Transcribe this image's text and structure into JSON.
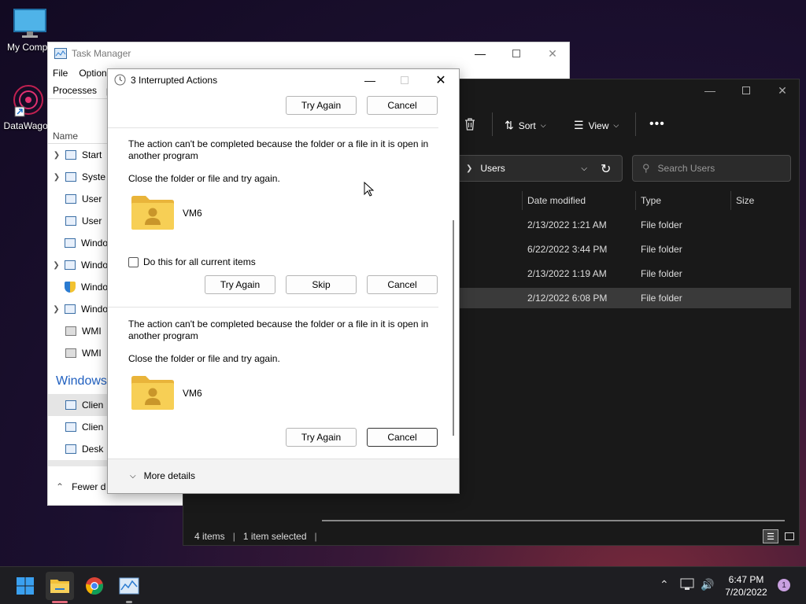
{
  "desktop": {
    "icons": [
      {
        "label": "My Compu"
      },
      {
        "label": "DataWagon"
      }
    ]
  },
  "task_manager": {
    "title": "Task Manager",
    "menu": [
      "File",
      "Option"
    ],
    "tabs": [
      "Processes",
      "p"
    ],
    "column_name": "Name",
    "rows": [
      "Start",
      "Syste",
      "User",
      "User",
      "Windo",
      "Windo",
      "Windo",
      "Windo",
      "WMI",
      "WMI"
    ],
    "section_label": "Windows",
    "section_rows": [
      "Clien",
      "Clien",
      "Desk"
    ],
    "fewer_details": "Fewer d"
  },
  "explorer": {
    "toolbar": {
      "sort": "Sort",
      "view": "View"
    },
    "address": {
      "paren": ")",
      "current": "Users"
    },
    "search_placeholder": "Search Users",
    "columns": {
      "date": "Date modified",
      "type": "Type",
      "size": "Size"
    },
    "rows": [
      {
        "date": "2/13/2022 1:21 AM",
        "type": "File folder"
      },
      {
        "date": "6/22/2022 3:44 PM",
        "type": "File folder"
      },
      {
        "date": "2/13/2022 1:19 AM",
        "type": "File folder"
      },
      {
        "date": "2/12/2022 6:08 PM",
        "type": "File folder",
        "selected": true
      }
    ],
    "status": {
      "items": "4 items",
      "selected": "1 item selected"
    }
  },
  "dialog": {
    "title": "3 Interrupted Actions",
    "top_buttons": {
      "try_again": "Try Again",
      "cancel": "Cancel"
    },
    "items": [
      {
        "message": "The action can't be completed because the folder or a file in it is open in another program",
        "hint": "Close the folder or file and try again.",
        "folder_name": "VM6",
        "checkbox_label": "Do this for all current items",
        "buttons": {
          "try_again": "Try Again",
          "skip": "Skip",
          "cancel": "Cancel"
        }
      },
      {
        "message": "The action can't be completed because the folder or a file in it is open in another program",
        "hint": "Close the folder or file and try again.",
        "folder_name": "VM6",
        "buttons": {
          "try_again": "Try Again",
          "cancel": "Cancel"
        }
      }
    ],
    "more_details": "More details"
  },
  "taskbar": {
    "time": "6:47 PM",
    "date": "7/20/2022",
    "notification_count": "1"
  },
  "colors": {
    "folder_yellow": "#f4c542",
    "explorer_bg": "#191919",
    "selected_row": "#3a3a3a"
  }
}
